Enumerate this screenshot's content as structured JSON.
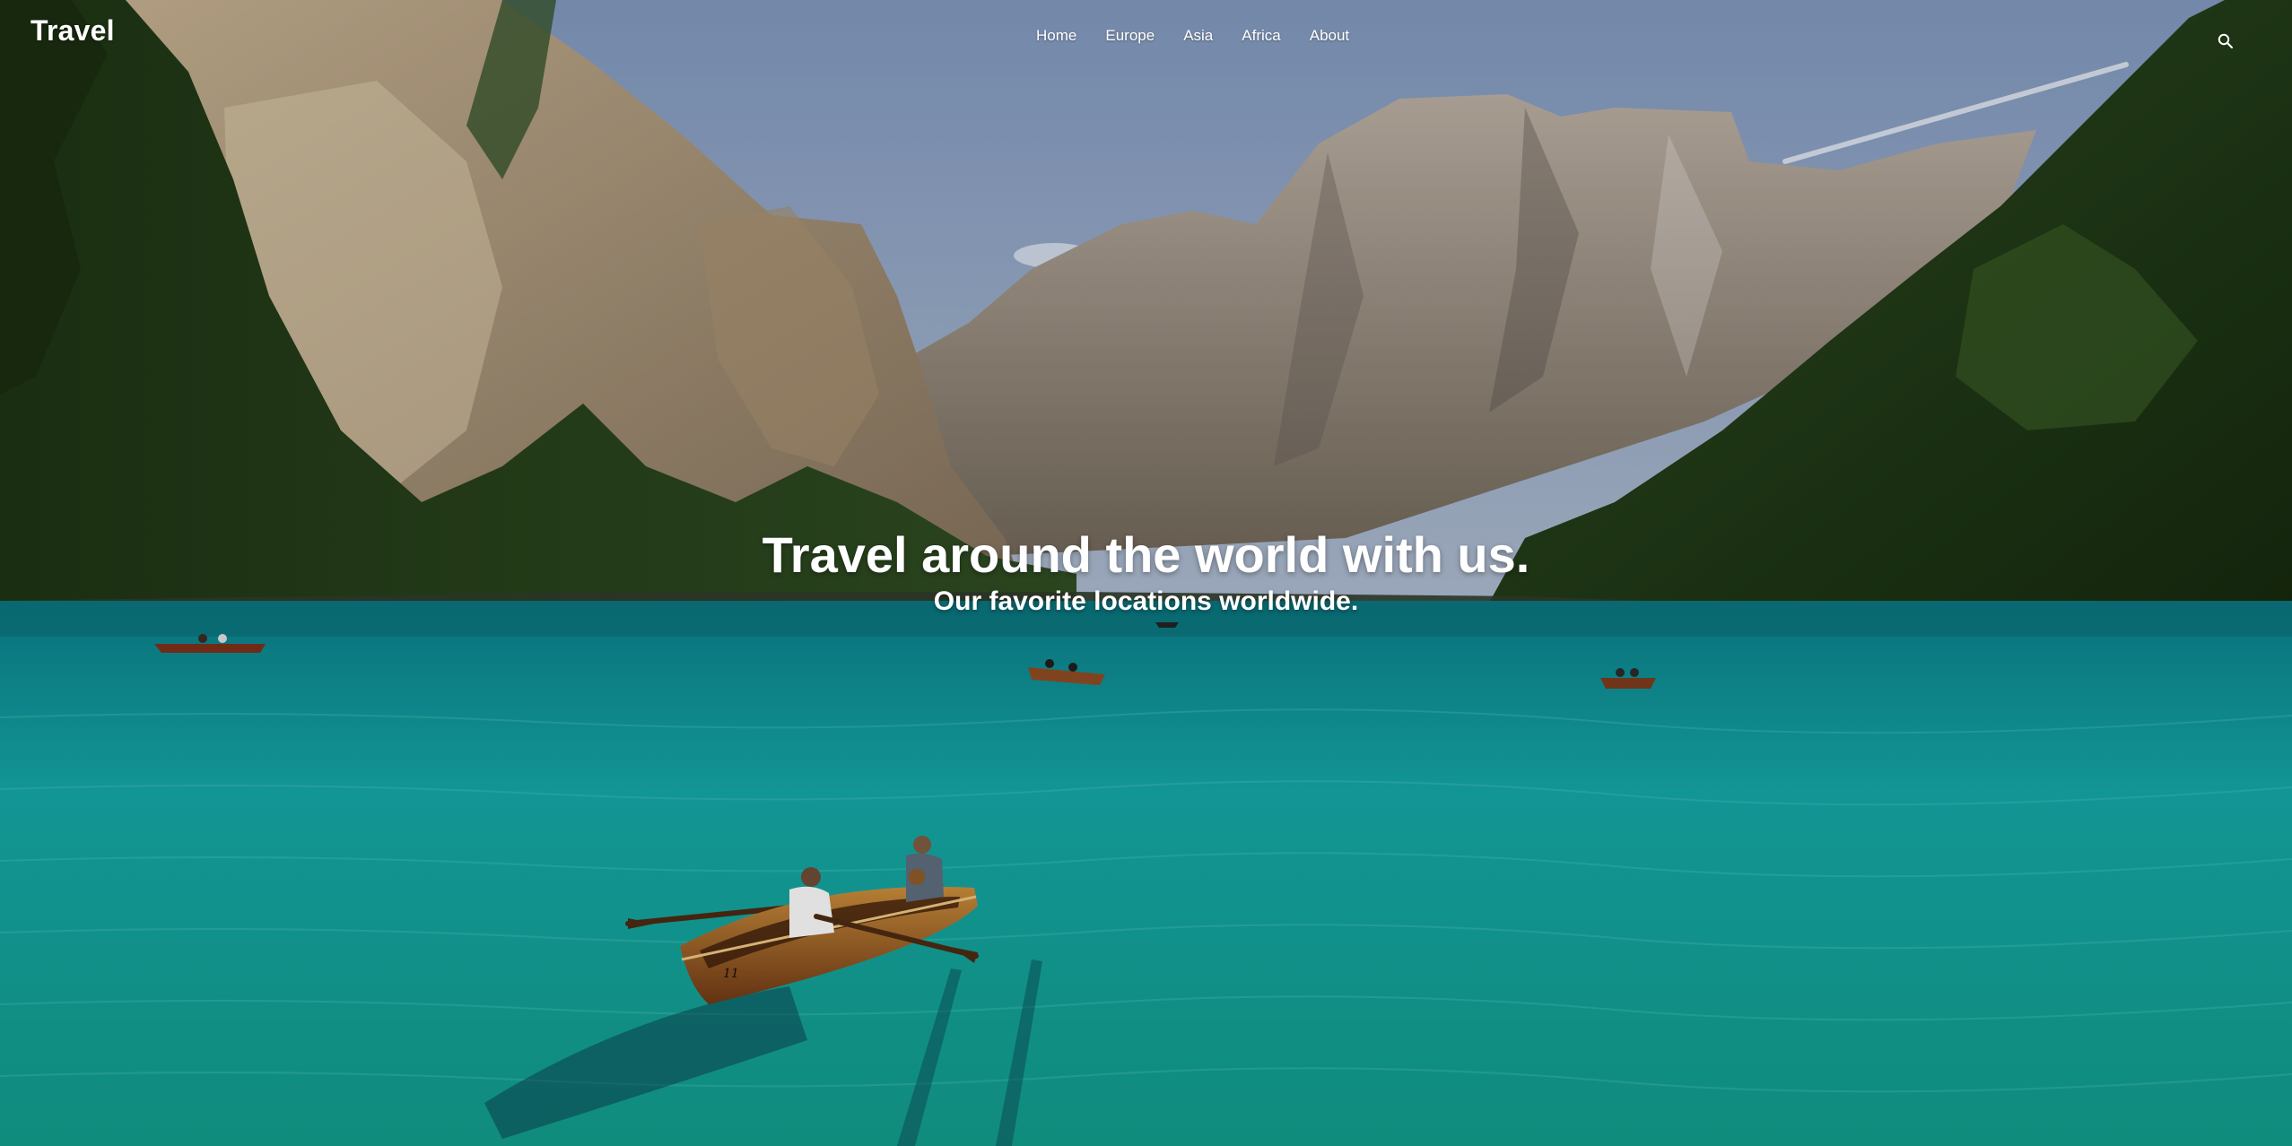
{
  "header": {
    "brand": "Travel",
    "nav": [
      {
        "label": "Home"
      },
      {
        "label": "Europe"
      },
      {
        "label": "Asia"
      },
      {
        "label": "Africa"
      },
      {
        "label": "About"
      }
    ],
    "search_icon": "search-icon"
  },
  "hero": {
    "headline": "Travel around the world with us.",
    "subheadline": "Our favorite locations worldwide.",
    "boat_number": "11"
  },
  "colors": {
    "sky": "#8fa3c4",
    "lake": "#1fa3a0",
    "forest": "#1f3d17",
    "rock": "#b9a792",
    "text": "#ffffff"
  }
}
